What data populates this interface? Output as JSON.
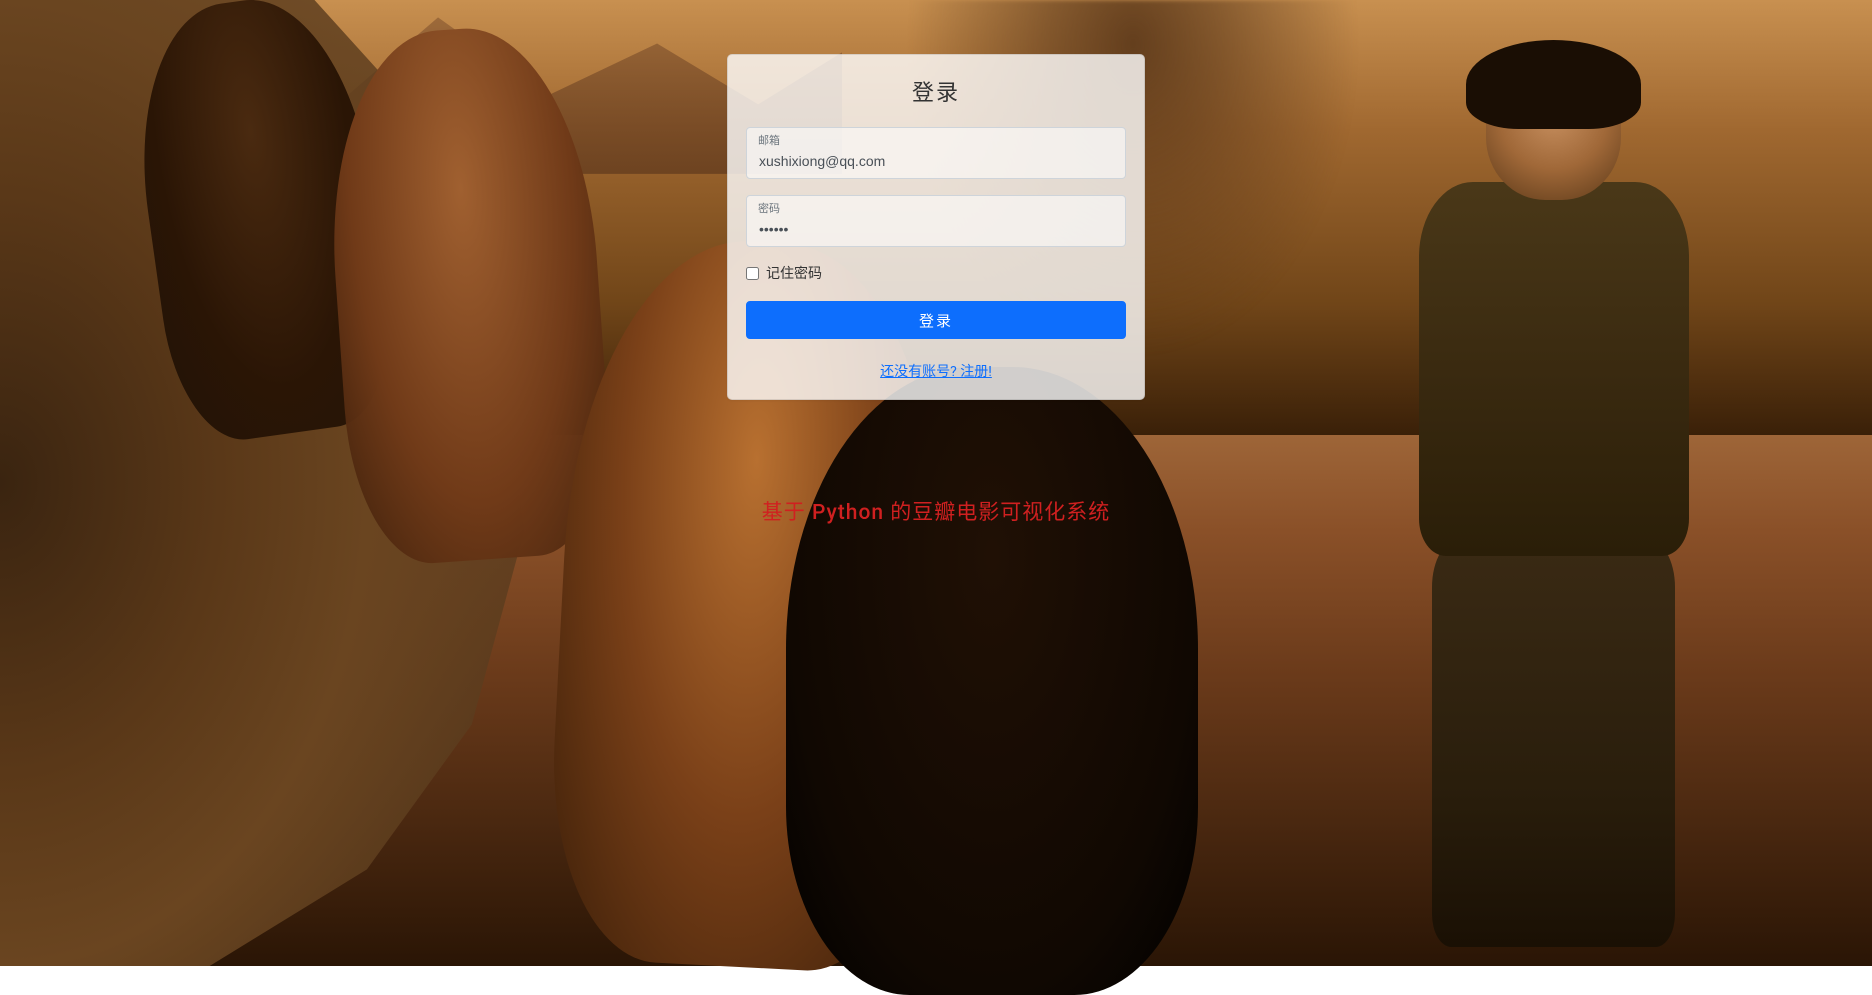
{
  "login": {
    "title": "登录",
    "email_label": "邮箱",
    "email_value": "xushixiong@qq.com",
    "password_label": "密码",
    "password_value": "123456",
    "remember_label": "记住密码",
    "remember_checked": false,
    "submit_label": "登录",
    "register_link": "还没有账号? 注册!"
  },
  "page": {
    "system_title": "基于 Python 的豆瓣电影可视化系统"
  }
}
